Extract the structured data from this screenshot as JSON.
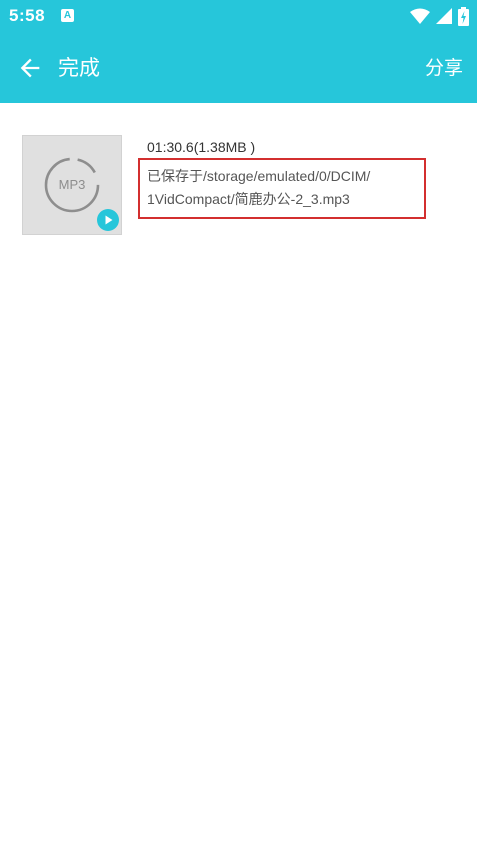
{
  "status_bar": {
    "time": "5:58",
    "notification_icon": "A"
  },
  "toolbar": {
    "title": "完成",
    "share_label": "分享"
  },
  "result": {
    "thumbnail_label": "MP3",
    "duration_size": "01:30.6(1.38MB )",
    "save_path_line1": "已保存于/storage/emulated/0/DCIM/",
    "save_path_line2": "1VidCompact/简鹿办公-2_3.mp3"
  },
  "colors": {
    "accent": "#26c6da",
    "highlight_border": "#d32f2f"
  }
}
